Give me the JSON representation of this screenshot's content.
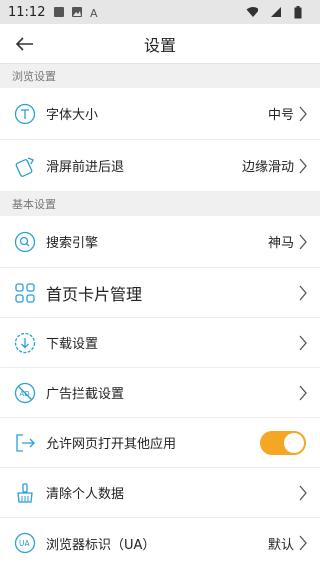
{
  "status_bar": {
    "time": "11:12"
  },
  "header": {
    "title": "设置"
  },
  "sections": [
    {
      "label": "浏览设置"
    },
    {
      "label": "基本设置"
    }
  ],
  "items": [
    {
      "label": "字体大小",
      "value": "中号",
      "icon": "font-size-icon"
    },
    {
      "label": "滑屏前进后退",
      "value": "边缘滑动",
      "icon": "swipe-gesture-icon"
    },
    {
      "label": "搜索引擎",
      "value": "神马",
      "icon": "search-icon"
    },
    {
      "label": "首页卡片管理",
      "value": "",
      "icon": "grid-icon"
    },
    {
      "label": "下载设置",
      "value": "",
      "icon": "download-icon"
    },
    {
      "label": "广告拦截设置",
      "value": "",
      "icon": "ad-block-icon"
    },
    {
      "label": "允许网页打开其他应用",
      "toggle_on": true,
      "icon": "open-app-icon"
    },
    {
      "label": "清除个人数据",
      "value": "",
      "icon": "broom-icon"
    },
    {
      "label": "浏览器标识（UA）",
      "value": "默认",
      "icon": "ua-icon"
    }
  ],
  "colors": {
    "accent": "#2a9fd8",
    "toggle_on": "#f5a623",
    "section_bg": "#f0f0f0"
  }
}
